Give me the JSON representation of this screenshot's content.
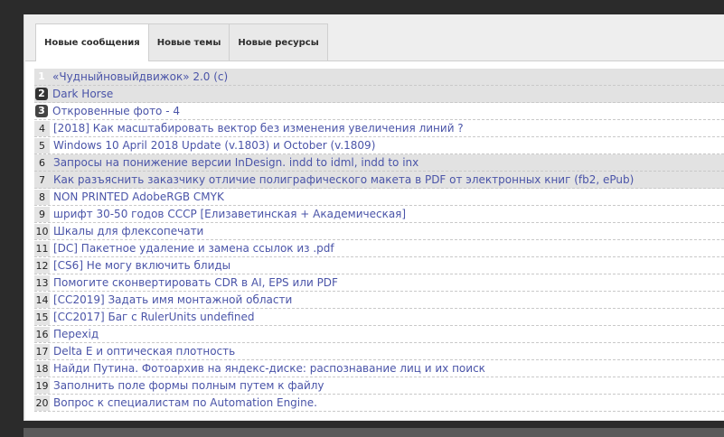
{
  "tabs": [
    {
      "label": "Новые сообщения"
    },
    {
      "label": "Новые темы"
    },
    {
      "label": "Новые ресурсы"
    }
  ],
  "topics": [
    {
      "num": "1",
      "title": "«Чудныйновыйдвижок» 2.0 (с)"
    },
    {
      "num": "2",
      "title": "Dark Horse"
    },
    {
      "num": "3",
      "title": "Откровенные фото - 4"
    },
    {
      "num": "4",
      "title": "[2018]  Как масштабировать вектор без изменения увеличения линий ?"
    },
    {
      "num": "5",
      "title": "Windows 10 April 2018 Update (v.1803) и October (v.1809)"
    },
    {
      "num": "6",
      "title": "Запросы на понижение версии InDesign. indd to idml, indd to inx"
    },
    {
      "num": "7",
      "title": "Как разъяснить заказчику отличие полиграфического макета в PDF от электронных книг (fb2, ePub)"
    },
    {
      "num": "8",
      "title": "NON PRINTED AdobeRGB CMYK"
    },
    {
      "num": "9",
      "title": "шрифт 30-50 годов СССР [Елизаветинская + Академическая]"
    },
    {
      "num": "10",
      "title": "Шкалы для флексопечати"
    },
    {
      "num": "11",
      "title": "[DC]  Пакетное удаление и замена ссылок из .pdf"
    },
    {
      "num": "12",
      "title": "[CS6]  Не могу включить блиды"
    },
    {
      "num": "13",
      "title": "Помогите сконвертировать CDR в AI, EPS или PDF"
    },
    {
      "num": "14",
      "title": "[CC2019]  Задать имя монтажной области"
    },
    {
      "num": "15",
      "title": "[CC2017]  Баг с RulerUnits undefined"
    },
    {
      "num": "16",
      "title": "Перехід"
    },
    {
      "num": "17",
      "title": "Delta E и оптическая плотность"
    },
    {
      "num": "18",
      "title": "Найди Путина. Фотоархив на яндекс-диске: распознавание лиц и их поиск"
    },
    {
      "num": "19",
      "title": "Заполнить поле формы полным путем к файлу"
    },
    {
      "num": "20",
      "title": "Вопрос к специалистам по Automation Engine."
    }
  ],
  "colors": {
    "link": "#4a54a8",
    "highlight_row": "#e2e2e2",
    "rank_badge": "#222222"
  }
}
